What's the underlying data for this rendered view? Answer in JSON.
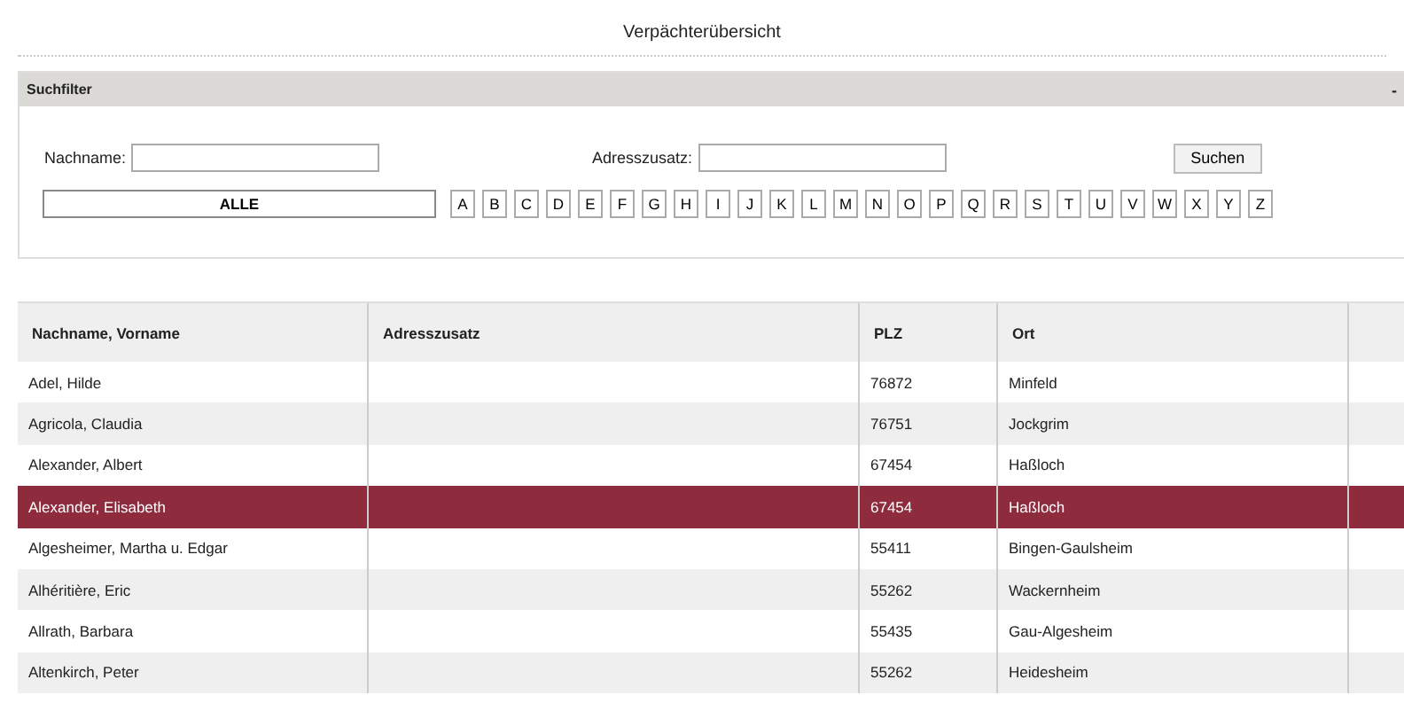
{
  "page_title": "Verpächterübersicht",
  "filter": {
    "title": "Suchfilter",
    "collapse": "-",
    "fields": [
      {
        "label": "Nachname:"
      },
      {
        "label": "Adresszusatz:"
      }
    ],
    "search_button": "Suchen",
    "letters": [
      {
        "label": "ALLE",
        "selected": true
      },
      {
        "label": "A",
        "selected": false
      },
      {
        "label": "B",
        "selected": false
      },
      {
        "label": "C",
        "selected": false
      },
      {
        "label": "D",
        "selected": false
      },
      {
        "label": "E",
        "selected": false
      },
      {
        "label": "F",
        "selected": false
      },
      {
        "label": "G",
        "selected": false
      },
      {
        "label": "H",
        "selected": false
      },
      {
        "label": "I",
        "selected": false
      },
      {
        "label": "J",
        "selected": false
      },
      {
        "label": "K",
        "selected": false
      },
      {
        "label": "L",
        "selected": false
      },
      {
        "label": "M",
        "selected": false
      },
      {
        "label": "N",
        "selected": false
      },
      {
        "label": "O",
        "selected": false
      },
      {
        "label": "P",
        "selected": false
      },
      {
        "label": "Q",
        "selected": false
      },
      {
        "label": "R",
        "selected": false
      },
      {
        "label": "S",
        "selected": false
      },
      {
        "label": "T",
        "selected": false
      },
      {
        "label": "U",
        "selected": false
      },
      {
        "label": "V",
        "selected": false
      },
      {
        "label": "W",
        "selected": false
      },
      {
        "label": "X",
        "selected": false
      },
      {
        "label": "Y",
        "selected": false
      },
      {
        "label": "Z",
        "selected": false
      }
    ]
  },
  "table": {
    "columns": [
      "Nachname, Vorname",
      "Adresszusatz",
      "PLZ",
      "Ort"
    ],
    "rows": [
      {
        "name": "Adel, Hilde",
        "plz": "76872",
        "ort": "Minfeld",
        "selected": false
      },
      {
        "name": "Agricola, Claudia",
        "plz": "76751",
        "ort": "Jockgrim",
        "selected": false
      },
      {
        "name": "Alexander, Albert",
        "plz": "67454",
        "ort": "Haßloch",
        "selected": false
      },
      {
        "name": "Alexander, Elisabeth",
        "plz": "67454",
        "ort": "Haßloch",
        "selected": true
      },
      {
        "name": "Algesheimer, Martha u. Edgar",
        "plz": "55411",
        "ort": "Bingen-Gaulsheim",
        "selected": false
      },
      {
        "name": "Alhéritière, Eric",
        "plz": "55262",
        "ort": "Wackernheim",
        "selected": false
      },
      {
        "name": "Allrath, Barbara",
        "plz": "55435",
        "ort": "Gau-Algesheim",
        "selected": false
      },
      {
        "name": "Altenkirch, Peter",
        "plz": "55262",
        "ort": "Heidesheim",
        "selected": false
      }
    ]
  }
}
